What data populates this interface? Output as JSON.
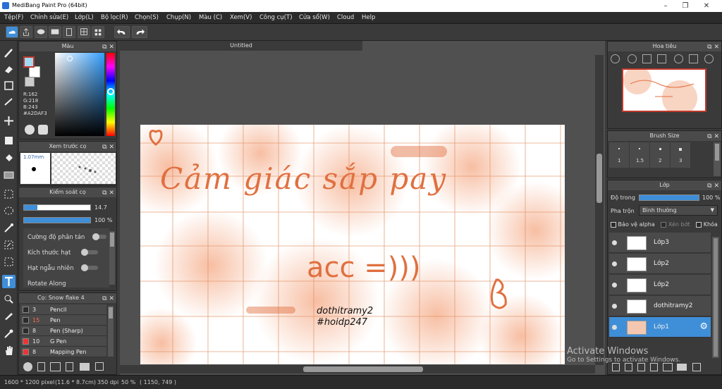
{
  "window": {
    "title": "MediBang Paint Pro (64bit)",
    "minimize": "–",
    "maximize": "❐",
    "close": "✕"
  },
  "menu": [
    "Tệp(F)",
    "Chỉnh sửa(E)",
    "Lớp(L)",
    "Bộ lọc(R)",
    "Chọn(S)",
    "Chụp(N)",
    "Màu (C)",
    "Xem(V)",
    "Công cụ(T)",
    "Cửa sổ(W)",
    "Cloud",
    "Help"
  ],
  "color_panel": {
    "title": "Màu",
    "r": "R:162",
    "g": "G:218",
    "b": "B:243",
    "hex": "#A2DAF3",
    "fg_color": "#a2daf3",
    "bg_color": "#ffffff"
  },
  "brush_preview": {
    "title": "Xem trước cọ",
    "size": "1.07mm"
  },
  "brush_control": {
    "title": "Kiểm soát cọ",
    "size_value": "14.7",
    "size_fraction": 0.2,
    "opacity_value": "100 %",
    "opacity_fraction": 1.0,
    "options": [
      "Cường độ phân tán",
      "Kích thước hạt",
      "Hạt ngẫu nhiên",
      "Rotate Along"
    ]
  },
  "brush_list": {
    "title": "Cọ: Snow flake 4",
    "items": [
      {
        "size": "3",
        "name": "Pencil",
        "size_color": "#e6e6e6"
      },
      {
        "size": "15",
        "name": "Pen",
        "size_color": "#ff6a4a"
      },
      {
        "size": "8",
        "name": "Pen (Sharp)",
        "size_color": "#e6e6e6"
      },
      {
        "size": "10",
        "name": "G Pen",
        "size_color": "#e6e6e6"
      },
      {
        "size": "8",
        "name": "Mapping Pen",
        "size_color": "#e6e6e6"
      }
    ]
  },
  "document": {
    "tab": "Untitled"
  },
  "canvas_art": {
    "line1": "Cảm giác sắp pay",
    "line2": "acc =)))",
    "tag1": "dothitramy2",
    "tag2": "#hoidp247",
    "accent": "#e07040"
  },
  "navigator": {
    "title": "Hoa tiêu"
  },
  "brush_size_panel": {
    "title": "Brush Size",
    "sizes": [
      "1",
      "1.5",
      "2",
      "3"
    ]
  },
  "layer_panel": {
    "title": "Lớp",
    "opacity_label": "Độ trong",
    "opacity_value": "100 %",
    "opacity_fraction": 1.0,
    "blend_label": "Pha trộn",
    "blend_value": "Bình thường",
    "protect_alpha": "Bảo vệ alpha",
    "clipping": "Xén bớt",
    "lock": "Khóa",
    "layers": [
      {
        "name": "Lớp3",
        "selected": false
      },
      {
        "name": "Lớp2",
        "selected": false
      },
      {
        "name": "Lớp2",
        "selected": false
      },
      {
        "name": "dothitramy2",
        "selected": false
      },
      {
        "name": "Lớp1",
        "selected": true
      }
    ]
  },
  "watermark": {
    "line1": "Activate Windows",
    "line2": "Go to Settings to activate Windows."
  },
  "status": {
    "pixels": "1600 * 1200 pixel",
    "size": "(11.6 * 8.7cm)",
    "dpi": "350 dpi",
    "zoom": "50 %",
    "coords": "( 1150, 749 )"
  }
}
